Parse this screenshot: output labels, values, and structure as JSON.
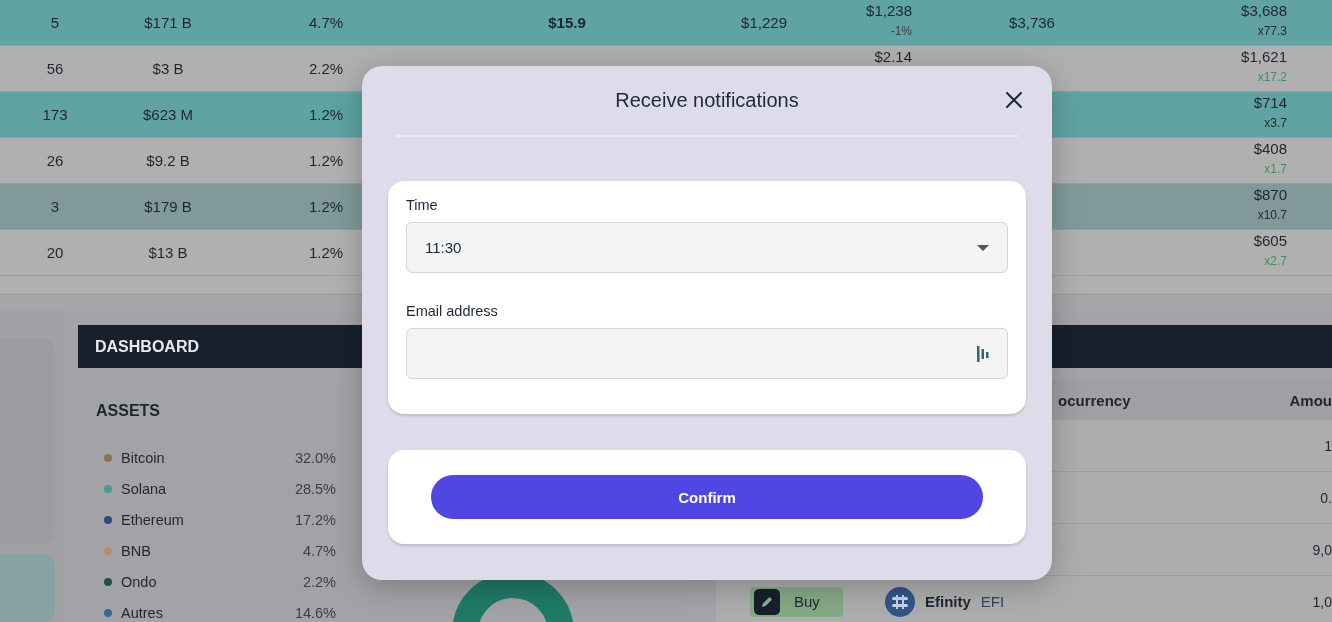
{
  "market_table": {
    "rows": [
      {
        "color": "#5fa3a3",
        "column_1": "5",
        "column_2": "$171 B",
        "column_3": "4.7%",
        "column_4": "$15.9",
        "column_5": "$1,229",
        "column_6": {
          "value": "$1,238",
          "change": "-1%"
        },
        "column_7": "$3,736",
        "column_8": {
          "value": "$3,688",
          "multiple": "x77.3",
          "color": "#24302f"
        }
      },
      {
        "color": "#b0b0b0",
        "column_1": "56",
        "column_2": "$3 B",
        "column_3": "2.2%",
        "column_6": {
          "value": "$2.14"
        },
        "column_8": {
          "value": "$1,621",
          "multiple": "x17.2",
          "color": "#3d8f63"
        }
      },
      {
        "color": "#5fa3a3",
        "column_1": "173",
        "column_2": "$623 M",
        "column_3": "1.2%",
        "column_8": {
          "value": "$714",
          "multiple": "x3.7",
          "color": "#24302f"
        }
      },
      {
        "color": "#b0b0b0",
        "column_1": "26",
        "column_2": "$9.2 B",
        "column_3": "1.2%",
        "column_8": {
          "value": "$408",
          "multiple": "x1.7",
          "color": "#3d8f63"
        }
      },
      {
        "color": "#819a99",
        "column_1": "3",
        "column_2": "$179 B",
        "column_3": "1.2%",
        "column_8": {
          "value": "$870",
          "multiple": "x10.7",
          "color": "#24302f"
        }
      },
      {
        "color": "#b0b0b0",
        "column_1": "20",
        "column_2": "$13 B",
        "column_3": "1.2%",
        "column_8": {
          "value": "$605",
          "multiple": "x2.7",
          "color": "#3d8f63"
        }
      }
    ]
  },
  "dashboard": {
    "title": "DASHBOARD",
    "assets": {
      "title": "ASSETS",
      "items": [
        {
          "name": "Bitcoin",
          "share": "32.0%",
          "color": "#94714e"
        },
        {
          "name": "Solana",
          "share": "28.5%",
          "color": "#3f9e90"
        },
        {
          "name": "Ethereum",
          "share": "17.2%",
          "color": "#35467e"
        },
        {
          "name": "BNB",
          "share": "4.7%",
          "color": "#b39061"
        },
        {
          "name": "Ondo",
          "share": "2.2%",
          "color": "#244f47"
        },
        {
          "name": "Autres",
          "share": "14.6%",
          "color": "#2f6f8c"
        }
      ]
    },
    "holdings_table": {
      "columns": [
        "ocurrency",
        "Amou"
      ],
      "rows": [
        {
          "amount": "1"
        },
        {
          "amount": "0."
        },
        {
          "amount": "9,0"
        },
        {
          "action": "Buy",
          "name": "Efinity",
          "symbol": "EFI",
          "amount": "1,0"
        }
      ]
    }
  },
  "dialog": {
    "title": "Receive notifications",
    "fields": [
      {
        "kind": "select",
        "label": "Time",
        "value": "11:30"
      },
      {
        "kind": "text",
        "label": "Email address"
      }
    ],
    "buttons": [
      {
        "label": "Confirm"
      }
    ]
  }
}
